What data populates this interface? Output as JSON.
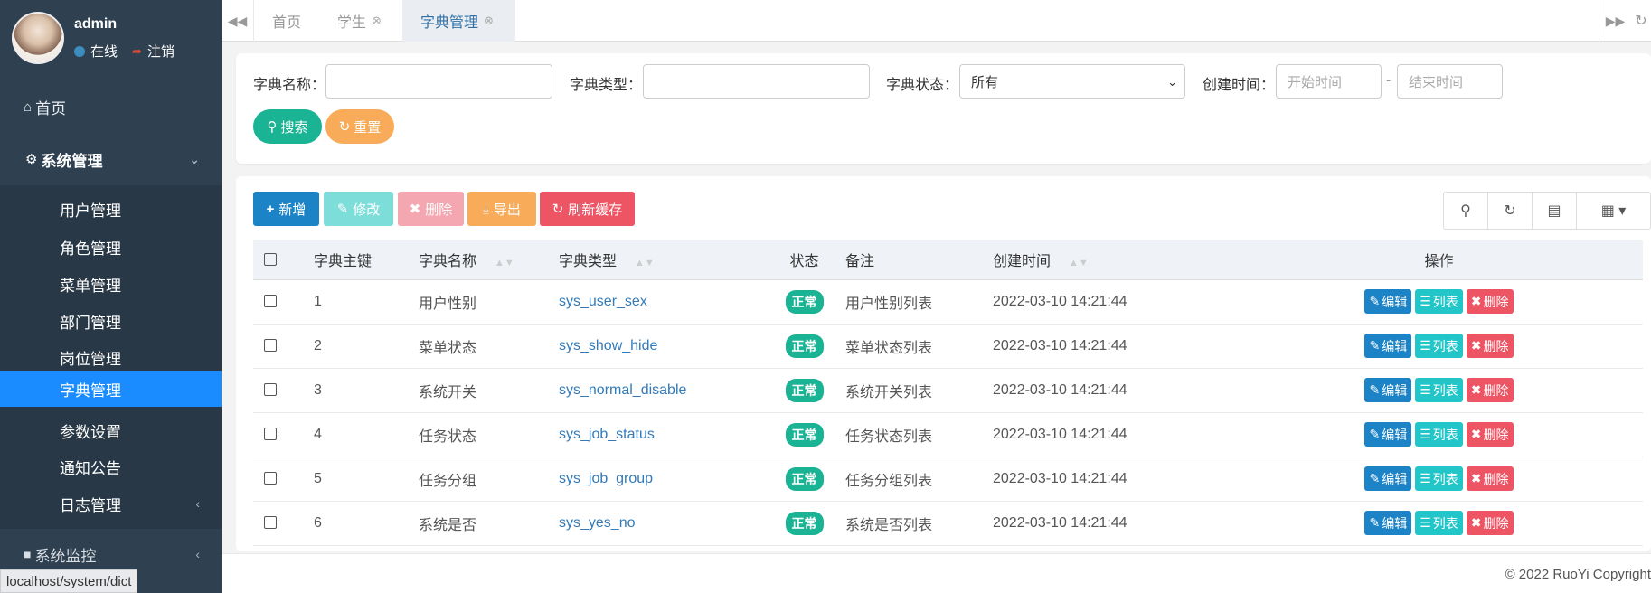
{
  "user": {
    "name": "admin",
    "status": "在线",
    "logout": "注销"
  },
  "sidebar": {
    "home": "首页",
    "system_menu": "系统管理",
    "items": [
      {
        "label": "用户管理"
      },
      {
        "label": "角色管理"
      },
      {
        "label": "菜单管理"
      },
      {
        "label": "部门管理"
      },
      {
        "label": "岗位管理"
      },
      {
        "label": "字典管理",
        "active": true
      },
      {
        "label": "参数设置"
      },
      {
        "label": "通知公告"
      },
      {
        "label": "日志管理",
        "has_children": true
      }
    ],
    "monitor_menu": "系统监控"
  },
  "status_url": "localhost/system/dict",
  "tabs": [
    {
      "label": "首页"
    },
    {
      "label": "学生",
      "closable": true
    },
    {
      "label": "字典管理",
      "closable": true,
      "active": true
    }
  ],
  "search": {
    "dict_name_label": "字典名称：",
    "dict_name_value": "",
    "dict_type_label": "字典类型：",
    "dict_type_value": "",
    "dict_status_label": "字典状态：",
    "dict_status_value": "所有",
    "create_time_label": "创建时间：",
    "start_placeholder": "开始时间",
    "end_placeholder": "结束时间",
    "separator": "-",
    "search_button": "搜索",
    "reset_button": "重置"
  },
  "toolbar": {
    "add": "新增",
    "edit": "修改",
    "delete": "删除",
    "export": "导出",
    "refresh_cache": "刷新缓存"
  },
  "table": {
    "headers": [
      "字典主键",
      "字典名称",
      "字典类型",
      "状态",
      "备注",
      "创建时间",
      "操作"
    ],
    "rows": [
      {
        "id": "1",
        "name": "用户性别",
        "type": "sys_user_sex",
        "status": "正常",
        "remark": "用户性别列表",
        "created": "2022-03-10 14:21:44"
      },
      {
        "id": "2",
        "name": "菜单状态",
        "type": "sys_show_hide",
        "status": "正常",
        "remark": "菜单状态列表",
        "created": "2022-03-10 14:21:44"
      },
      {
        "id": "3",
        "name": "系统开关",
        "type": "sys_normal_disable",
        "status": "正常",
        "remark": "系统开关列表",
        "created": "2022-03-10 14:21:44"
      },
      {
        "id": "4",
        "name": "任务状态",
        "type": "sys_job_status",
        "status": "正常",
        "remark": "任务状态列表",
        "created": "2022-03-10 14:21:44"
      },
      {
        "id": "5",
        "name": "任务分组",
        "type": "sys_job_group",
        "status": "正常",
        "remark": "任务分组列表",
        "created": "2022-03-10 14:21:44"
      },
      {
        "id": "6",
        "name": "系统是否",
        "type": "sys_yes_no",
        "status": "正常",
        "remark": "系统是否列表",
        "created": "2022-03-10 14:21:44"
      }
    ],
    "row_actions": {
      "edit": "编辑",
      "list": "列表",
      "delete": "删除"
    }
  },
  "footer": "© 2022 RuoYi Copyright",
  "colors": {
    "sidebar_bg": "#2f4050",
    "active_menu": "#1a8cff",
    "primary": "#1c84c6",
    "success": "#1ab394",
    "info": "#23c6c8",
    "danger": "#ed5565",
    "warning": "#f8ac59"
  }
}
